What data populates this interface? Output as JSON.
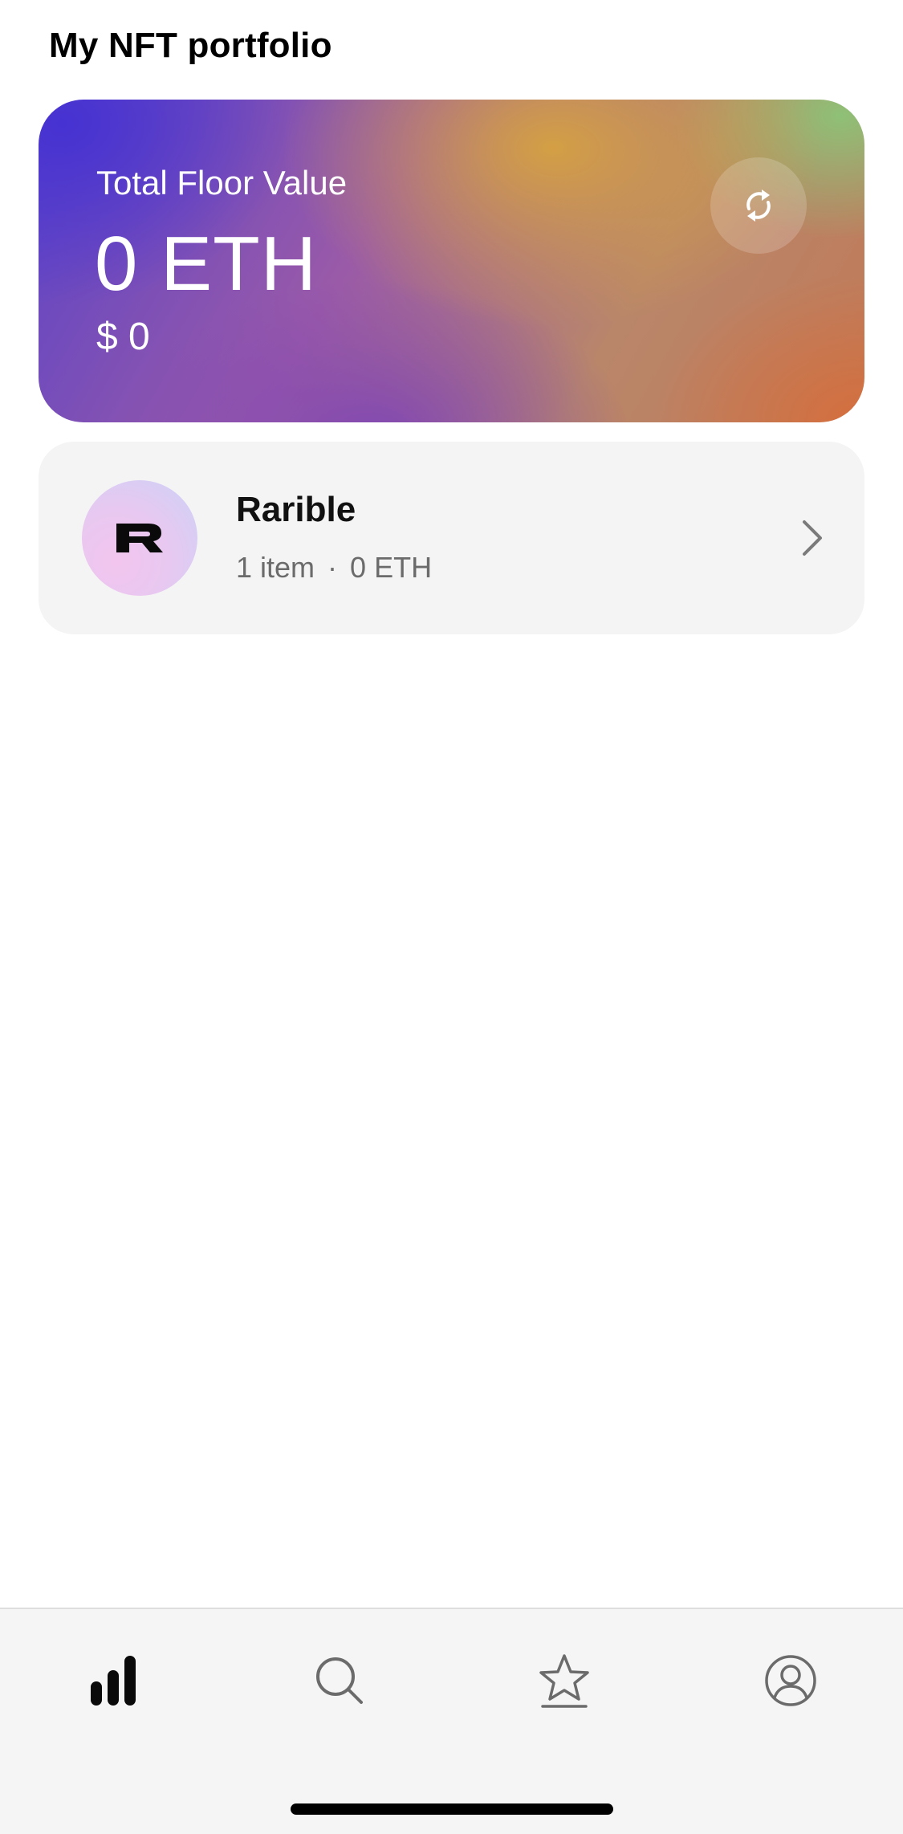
{
  "header": {
    "title": "My NFT portfolio"
  },
  "floor_card": {
    "label": "Total Floor Value",
    "eth_value": "0 ETH",
    "usd_value": "$ 0",
    "refresh_icon": "refresh-icon"
  },
  "collections": [
    {
      "name": "Rarible",
      "logo_letter": "R",
      "item_count": "1 item",
      "separator": "·",
      "value": "0 ETH",
      "chevron_icon": "chevron-right-icon"
    }
  ],
  "tabbar": {
    "tabs": [
      {
        "icon": "portfolio-chart-icon",
        "active": true
      },
      {
        "icon": "search-icon",
        "active": false
      },
      {
        "icon": "star-icon",
        "active": false
      },
      {
        "icon": "profile-icon",
        "active": false
      }
    ]
  },
  "colors": {
    "card_gradient_start": "#4632d2",
    "card_gradient_mid": "#d6a240",
    "card_gradient_end": "#d66e3c",
    "collection_bg": "#f4f4f4",
    "tabbar_bg": "#f5f5f5",
    "inactive_icon": "#6b6b6b"
  }
}
